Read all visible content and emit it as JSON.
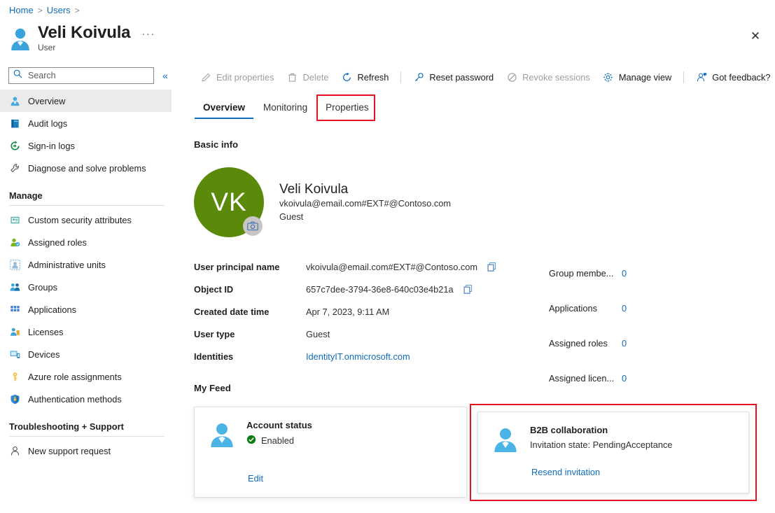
{
  "breadcrumb": {
    "items": [
      "Home",
      "Users"
    ],
    "separator": ">"
  },
  "header": {
    "title": "Veli Koivula",
    "subtitle": "User",
    "more_label": "···",
    "close_label": "✕"
  },
  "search": {
    "placeholder": "Search",
    "value": "",
    "collapse_label": "«"
  },
  "sidebar": {
    "items": [
      {
        "label": "Overview",
        "icon": "user-icon",
        "selected": true
      },
      {
        "label": "Audit logs",
        "icon": "book-icon",
        "selected": false
      },
      {
        "label": "Sign-in logs",
        "icon": "signin-icon",
        "selected": false
      },
      {
        "label": "Diagnose and solve problems",
        "icon": "wrench-icon",
        "selected": false
      }
    ],
    "groups": [
      {
        "title": "Manage",
        "items": [
          {
            "label": "Custom security attributes",
            "icon": "attributes-icon"
          },
          {
            "label": "Assigned roles",
            "icon": "roles-icon"
          },
          {
            "label": "Administrative units",
            "icon": "admin-units-icon"
          },
          {
            "label": "Groups",
            "icon": "groups-icon"
          },
          {
            "label": "Applications",
            "icon": "applications-icon"
          },
          {
            "label": "Licenses",
            "icon": "licenses-icon"
          },
          {
            "label": "Devices",
            "icon": "devices-icon"
          },
          {
            "label": "Azure role assignments",
            "icon": "key-icon"
          },
          {
            "label": "Authentication methods",
            "icon": "shield-icon"
          }
        ]
      },
      {
        "title": "Troubleshooting + Support",
        "items": [
          {
            "label": "New support request",
            "icon": "support-icon"
          }
        ]
      }
    ]
  },
  "toolbar": {
    "buttons": [
      {
        "label": "Edit properties",
        "icon": "pencil-icon",
        "disabled": true
      },
      {
        "label": "Delete",
        "icon": "trash-icon",
        "disabled": true
      },
      {
        "label": "Refresh",
        "icon": "refresh-icon",
        "disabled": false
      },
      {
        "label": "Reset password",
        "icon": "key-icon",
        "disabled": false
      },
      {
        "label": "Revoke sessions",
        "icon": "block-icon",
        "disabled": true
      },
      {
        "label": "Manage view",
        "icon": "gear-icon",
        "disabled": false
      },
      {
        "label": "Got feedback?",
        "icon": "feedback-icon",
        "disabled": false
      }
    ]
  },
  "tabs": [
    {
      "label": "Overview",
      "active": true
    },
    {
      "label": "Monitoring",
      "active": false
    },
    {
      "label": "Properties",
      "active": false,
      "highlighted": true
    }
  ],
  "main": {
    "basic_info_title": "Basic info",
    "my_feed_title": "My Feed",
    "profile": {
      "initials": "VK",
      "name": "Veli Koivula",
      "email": "vkoivula@email.com#EXT#@Contoso.com",
      "user_type": "Guest",
      "avatar_color": "#5b8a0b",
      "camera_icon": "camera-icon"
    },
    "properties": [
      {
        "label": "User principal name",
        "value": "vkoivula@email.com#EXT#@Contoso.com",
        "copy": true,
        "link": false
      },
      {
        "label": "Object ID",
        "value": "657c7dee-3794-36e8-640c03e4b21a",
        "copy": true,
        "link": false
      },
      {
        "label": "Created date time",
        "value": "Apr 7, 2023, 9:11 AM",
        "copy": false,
        "link": false
      },
      {
        "label": "User type",
        "value": "Guest",
        "copy": false,
        "link": false
      },
      {
        "label": "Identities",
        "value": "IdentityIT.onmicrosoft.com",
        "copy": false,
        "link": true
      }
    ],
    "stats": [
      {
        "label": "Group membe...",
        "value": "0"
      },
      {
        "label": "Applications",
        "value": "0"
      },
      {
        "label": "Assigned roles",
        "value": "0"
      },
      {
        "label": "Assigned licen...",
        "value": "0"
      }
    ],
    "feed_cards": [
      {
        "title": "Account status",
        "status": "Enabled",
        "status_icon": "check-circle-icon",
        "link": "Edit"
      },
      {
        "title": "B2B collaboration",
        "subtitle": "Invitation state: PendingAcceptance",
        "link": "Resend invitation"
      }
    ]
  },
  "colors": {
    "accent": "#0f6cbd",
    "highlight": "#e81123",
    "avatar_green": "#5b8a0b",
    "status_green": "#107c10",
    "selected_row": "#ebebeb"
  }
}
